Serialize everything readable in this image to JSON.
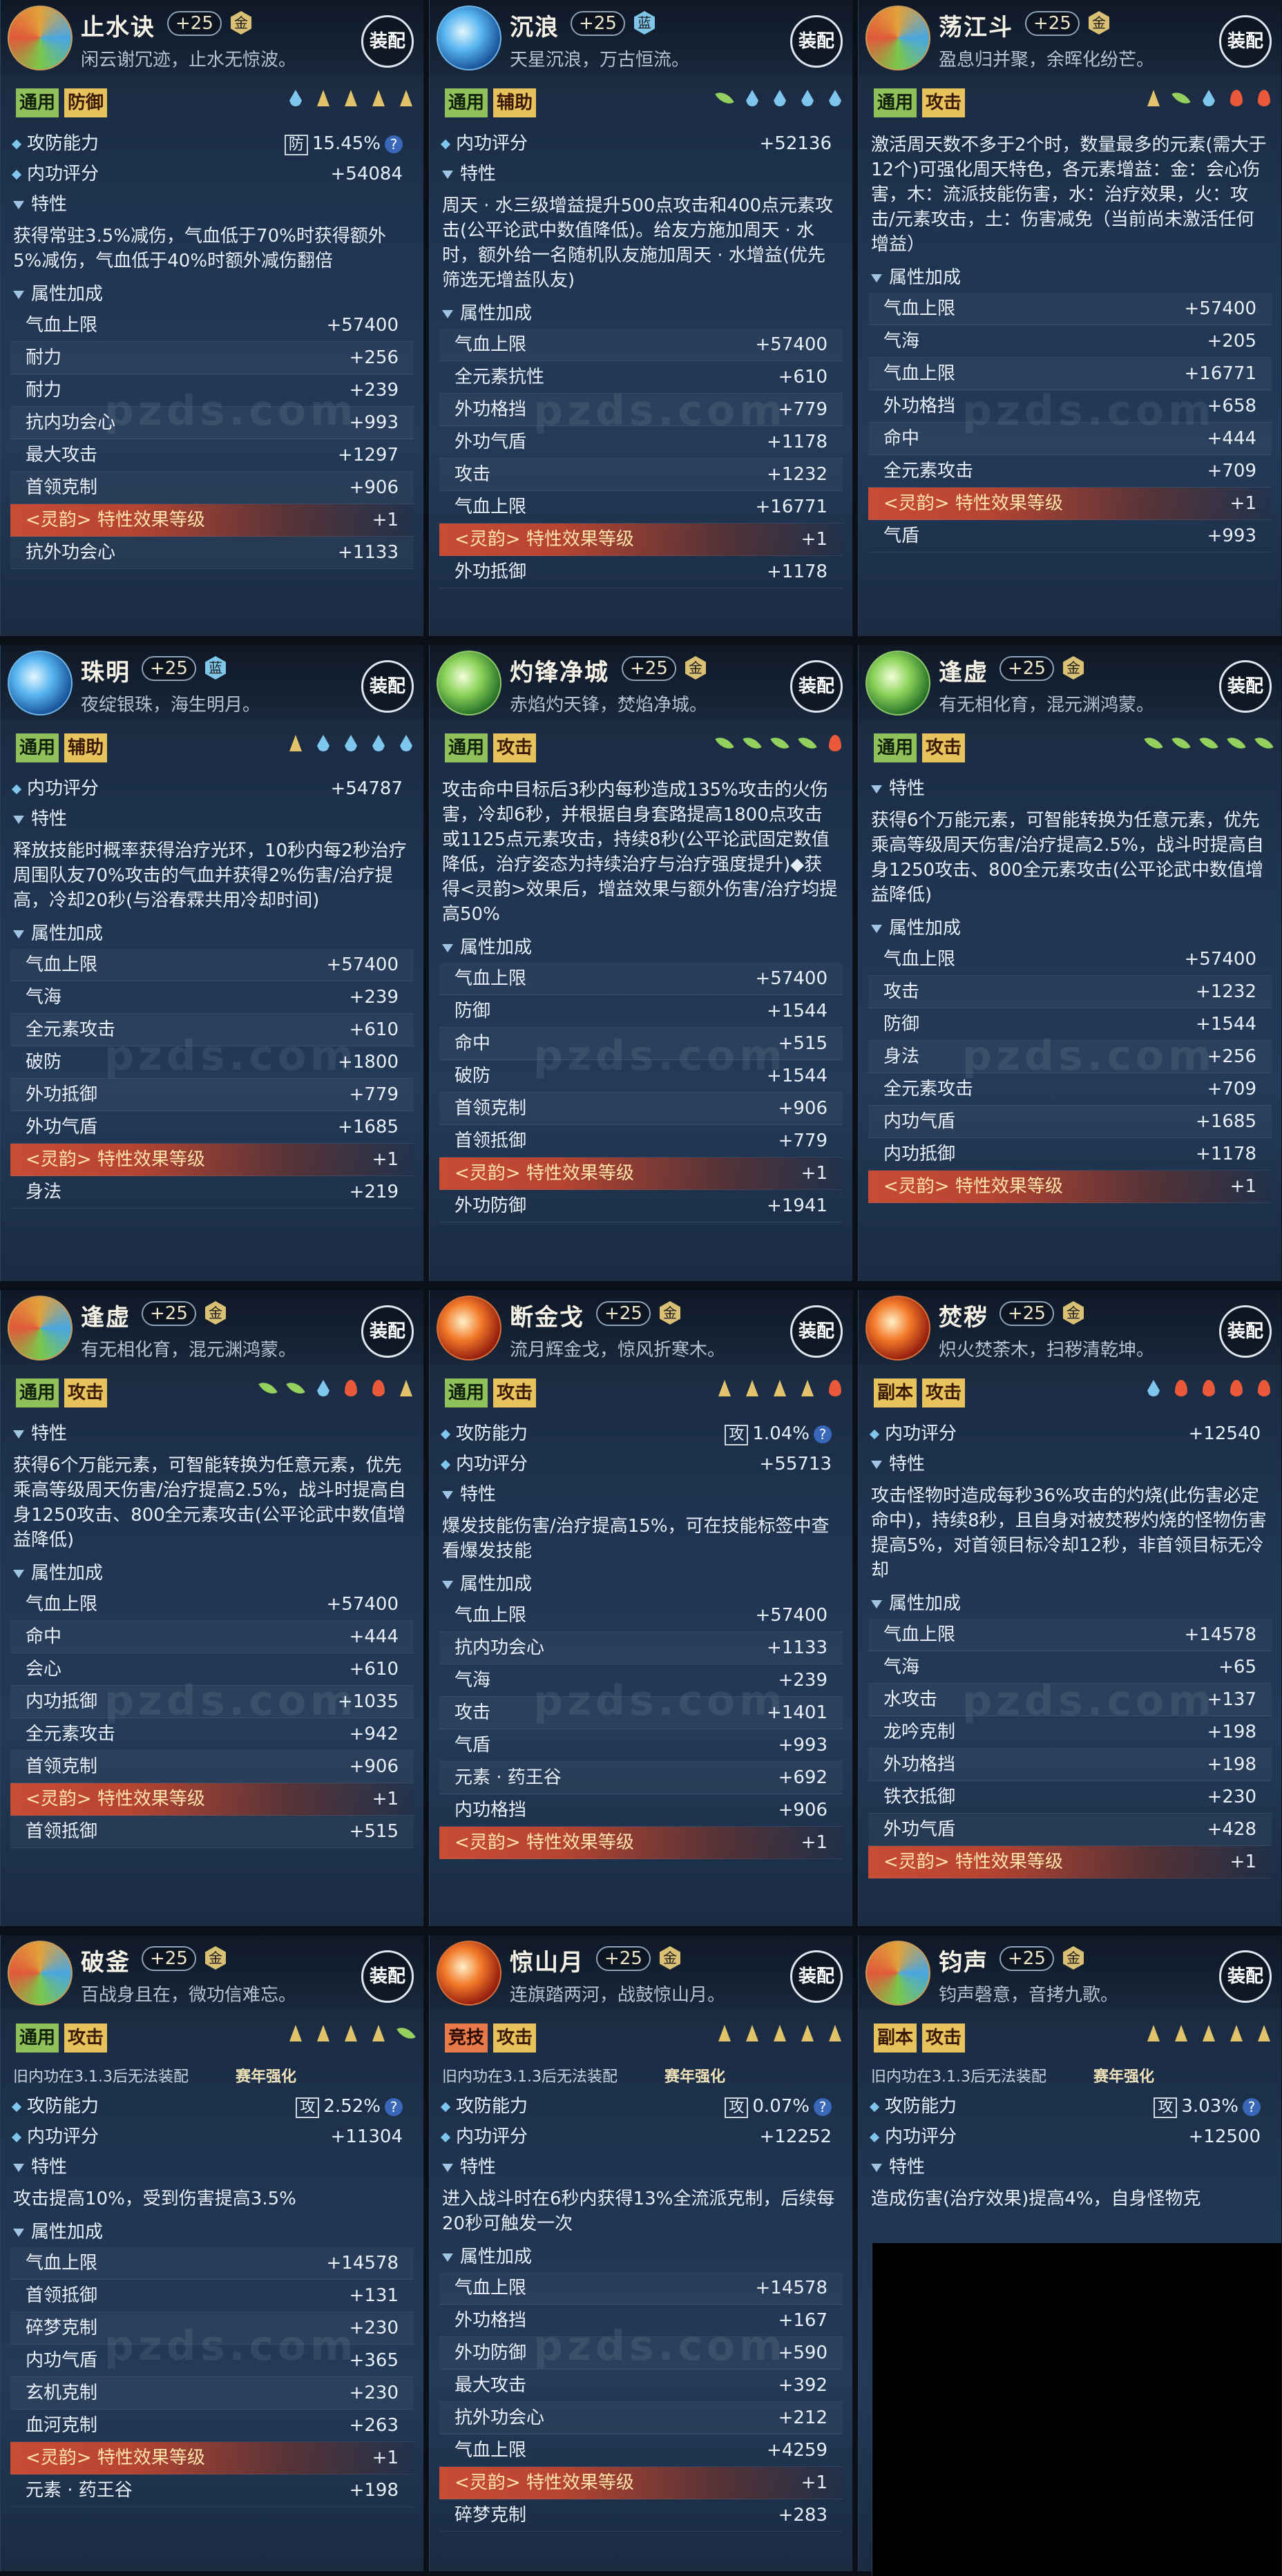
{
  "buttons": {
    "equip": "装配"
  },
  "watermark": "pzds.com",
  "sections": {
    "rating": "内功评分",
    "atk_def": "攻防能力",
    "trait": "特性",
    "attrs": "属性加成"
  },
  "cards": [
    {
      "title": "止水诀",
      "level": "+25",
      "badge": "金",
      "subtitle": "闲云谢冗迹，止水无惊波。",
      "tags": [
        {
          "text": "通用",
          "c": "g"
        },
        {
          "text": "防御",
          "c": "y"
        }
      ],
      "elements": [
        "water",
        "earth",
        "earth",
        "earth",
        "earth"
      ],
      "rows": [
        {
          "t": "sec",
          "icon": "dot",
          "label": "攻防能力",
          "box": "防",
          "value": "15.45%",
          "q": "?"
        },
        {
          "t": "sec",
          "icon": "dot",
          "label": "内功评分",
          "value": "+54084"
        },
        {
          "t": "sec",
          "icon": "tri",
          "label": "特性"
        },
        {
          "t": "desc",
          "text": "获得常驻3.5%减伤，气血低于70%时获得额外5%减伤，气血低于40%时额外减伤翻倍"
        },
        {
          "t": "sec",
          "icon": "tri",
          "label": "属性加成"
        },
        {
          "t": "stat",
          "name": "气血上限",
          "value": "+57400"
        },
        {
          "t": "stat",
          "name": "耐力",
          "value": "+256"
        },
        {
          "t": "stat",
          "name": "耐力",
          "value": "+239"
        },
        {
          "t": "stat",
          "name": "抗内功会心",
          "value": "+993"
        },
        {
          "t": "stat",
          "name": "最大攻击",
          "value": "+1297"
        },
        {
          "t": "stat",
          "name": "首领克制",
          "value": "+906"
        },
        {
          "t": "res",
          "name": "<灵韵> 特性效果等级",
          "value": "+1"
        },
        {
          "t": "stat",
          "name": "抗外功会心",
          "value": "+1133"
        }
      ]
    },
    {
      "title": "沉浪",
      "level": "+25",
      "badge": "蓝",
      "subtitle": "天星沉浪，万古恒流。",
      "tags": [
        {
          "text": "通用",
          "c": "g"
        },
        {
          "text": "辅助",
          "c": "y"
        }
      ],
      "elements": [
        "wood",
        "water",
        "water",
        "water",
        "water"
      ],
      "rows": [
        {
          "t": "sec",
          "icon": "dot",
          "label": "内功评分",
          "value": "+52136"
        },
        {
          "t": "sec",
          "icon": "tri",
          "label": "特性"
        },
        {
          "t": "desc",
          "text": "周天 · 水三级增益提升500点攻击和400点元素攻击(公平论武中数值降低)。给友方施加周天 · 水时，额外给一名随机队友施加周天 · 水增益(优先筛选无增益队友)"
        },
        {
          "t": "sec",
          "icon": "tri",
          "label": "属性加成"
        },
        {
          "t": "stat",
          "name": "气血上限",
          "value": "+57400"
        },
        {
          "t": "stat",
          "name": "全元素抗性",
          "value": "+610"
        },
        {
          "t": "stat",
          "name": "外功格挡",
          "value": "+779"
        },
        {
          "t": "stat",
          "name": "外功气盾",
          "value": "+1178"
        },
        {
          "t": "stat",
          "name": "攻击",
          "value": "+1232"
        },
        {
          "t": "stat",
          "name": "气血上限",
          "value": "+16771"
        },
        {
          "t": "res",
          "name": "<灵韵> 特性效果等级",
          "value": "+1"
        },
        {
          "t": "stat",
          "name": "外功抵御",
          "value": "+1178"
        }
      ]
    },
    {
      "title": "荡江斗",
      "level": "+25",
      "badge": "金",
      "subtitle": "盈息归并聚，余晖化纷芒。",
      "tags": [
        {
          "text": "通用",
          "c": "g"
        },
        {
          "text": "攻击",
          "c": "y"
        }
      ],
      "elements": [
        "earth",
        "wood",
        "water",
        "fire",
        "fire"
      ],
      "rows": [
        {
          "t": "desc",
          "text": "激活周天数不多于2个时，数量最多的元素(需大于12个)可强化周天特色，各元素增益：金：会心伤害，木：流派技能伤害，水：治疗效果，火：攻击/元素攻击，土：伤害减免（当前尚未激活任何增益）"
        },
        {
          "t": "sec",
          "icon": "tri",
          "label": "属性加成"
        },
        {
          "t": "stat",
          "name": "气血上限",
          "value": "+57400"
        },
        {
          "t": "stat",
          "name": "气海",
          "value": "+205"
        },
        {
          "t": "stat",
          "name": "气血上限",
          "value": "+16771"
        },
        {
          "t": "stat",
          "name": "外功格挡",
          "value": "+658"
        },
        {
          "t": "stat",
          "name": "命中",
          "value": "+444"
        },
        {
          "t": "stat",
          "name": "全元素攻击",
          "value": "+709"
        },
        {
          "t": "res",
          "name": "<灵韵> 特性效果等级",
          "value": "+1"
        },
        {
          "t": "stat",
          "name": "气盾",
          "value": "+993"
        }
      ]
    },
    {
      "title": "珠明",
      "level": "+25",
      "badge": "蓝",
      "subtitle": "夜绽银珠，海生明月。",
      "tags": [
        {
          "text": "通用",
          "c": "g"
        },
        {
          "text": "辅助",
          "c": "y"
        }
      ],
      "elements": [
        "earth",
        "water",
        "water",
        "water",
        "water"
      ],
      "rows": [
        {
          "t": "sec",
          "icon": "dot",
          "label": "内功评分",
          "value": "+54787"
        },
        {
          "t": "sec",
          "icon": "tri",
          "label": "特性"
        },
        {
          "t": "desc",
          "text": "释放技能时概率获得治疗光环，10秒内每2秒治疗周围队友70%攻击的气血并获得2%伤害/治疗提高，冷却20秒(与浴春霖共用冷却时间)"
        },
        {
          "t": "sec",
          "icon": "tri",
          "label": "属性加成"
        },
        {
          "t": "stat",
          "name": "气血上限",
          "value": "+57400"
        },
        {
          "t": "stat",
          "name": "气海",
          "value": "+239"
        },
        {
          "t": "stat",
          "name": "全元素攻击",
          "value": "+610"
        },
        {
          "t": "stat",
          "name": "破防",
          "value": "+1800"
        },
        {
          "t": "stat",
          "name": "外功抵御",
          "value": "+779"
        },
        {
          "t": "stat",
          "name": "外功气盾",
          "value": "+1685"
        },
        {
          "t": "res",
          "name": "<灵韵> 特性效果等级",
          "value": "+1"
        },
        {
          "t": "stat",
          "name": "身法",
          "value": "+219"
        }
      ]
    },
    {
      "title": "灼锋净城",
      "level": "+25",
      "badge": "金",
      "subtitle": "赤焰灼天锋，焚焰净城。",
      "tags": [
        {
          "text": "通用",
          "c": "g"
        },
        {
          "text": "攻击",
          "c": "y"
        }
      ],
      "elements": [
        "wood",
        "wood",
        "wood",
        "wood",
        "fire"
      ],
      "rows": [
        {
          "t": "desc",
          "text": "攻击命中目标后3秒内每秒造成135%攻击的火伤害，冷却6秒，并根据自身套路提高1800点攻击或1125点元素攻击，持续8秒(公平论武固定数值降低，治疗姿态为持续治疗与治疗强度提升)◆获得<灵韵>效果后，增益效果与额外伤害/治疗均提高50%"
        },
        {
          "t": "sec",
          "icon": "tri",
          "label": "属性加成"
        },
        {
          "t": "stat",
          "name": "气血上限",
          "value": "+57400"
        },
        {
          "t": "stat",
          "name": "防御",
          "value": "+1544"
        },
        {
          "t": "stat",
          "name": "命中",
          "value": "+515"
        },
        {
          "t": "stat",
          "name": "破防",
          "value": "+1544"
        },
        {
          "t": "stat",
          "name": "首领克制",
          "value": "+906"
        },
        {
          "t": "stat",
          "name": "首领抵御",
          "value": "+779"
        },
        {
          "t": "res",
          "name": "<灵韵> 特性效果等级",
          "value": "+1"
        },
        {
          "t": "stat",
          "name": "外功防御",
          "value": "+1941"
        }
      ]
    },
    {
      "title": "逢虚",
      "level": "+25",
      "badge": "金",
      "subtitle": "有无相化育，混元渊鸿蒙。",
      "tags": [
        {
          "text": "通用",
          "c": "g"
        },
        {
          "text": "攻击",
          "c": "y"
        }
      ],
      "elements": [
        "wood",
        "wood",
        "wood",
        "wood",
        "wood"
      ],
      "rows": [
        {
          "t": "sec",
          "icon": "tri",
          "label": "特性"
        },
        {
          "t": "desc",
          "text": "获得6个万能元素，可智能转换为任意元素，优先乘高等级周天伤害/治疗提高2.5%，战斗时提高自身1250攻击、800全元素攻击(公平论武中数值增益降低)"
        },
        {
          "t": "sec",
          "icon": "tri",
          "label": "属性加成"
        },
        {
          "t": "stat",
          "name": "气血上限",
          "value": "+57400"
        },
        {
          "t": "stat",
          "name": "攻击",
          "value": "+1232"
        },
        {
          "t": "stat",
          "name": "防御",
          "value": "+1544"
        },
        {
          "t": "stat",
          "name": "身法",
          "value": "+256"
        },
        {
          "t": "stat",
          "name": "全元素攻击",
          "value": "+709"
        },
        {
          "t": "stat",
          "name": "内功气盾",
          "value": "+1685"
        },
        {
          "t": "stat",
          "name": "内功抵御",
          "value": "+1178"
        },
        {
          "t": "res",
          "name": "<灵韵> 特性效果等级",
          "value": "+1"
        }
      ]
    },
    {
      "title": "逢虚",
      "level": "+25",
      "badge": "金",
      "subtitle": "有无相化育，混元渊鸿蒙。",
      "tags": [
        {
          "text": "通用",
          "c": "g"
        },
        {
          "text": "攻击",
          "c": "y"
        }
      ],
      "elements": [
        "wood",
        "wood",
        "water",
        "fire",
        "fire",
        "earth"
      ],
      "rows": [
        {
          "t": "sec",
          "icon": "tri",
          "label": "特性"
        },
        {
          "t": "desc",
          "text": "获得6个万能元素，可智能转换为任意元素，优先乘高等级周天伤害/治疗提高2.5%，战斗时提高自身1250攻击、800全元素攻击(公平论武中数值增益降低)"
        },
        {
          "t": "sec",
          "icon": "tri",
          "label": "属性加成"
        },
        {
          "t": "stat",
          "name": "气血上限",
          "value": "+57400"
        },
        {
          "t": "stat",
          "name": "命中",
          "value": "+444"
        },
        {
          "t": "stat",
          "name": "会心",
          "value": "+610"
        },
        {
          "t": "stat",
          "name": "内功抵御",
          "value": "+1035"
        },
        {
          "t": "stat",
          "name": "全元素攻击",
          "value": "+942"
        },
        {
          "t": "stat",
          "name": "首领克制",
          "value": "+906"
        },
        {
          "t": "res",
          "name": "<灵韵> 特性效果等级",
          "value": "+1"
        },
        {
          "t": "stat",
          "name": "首领抵御",
          "value": "+515"
        }
      ]
    },
    {
      "title": "断金戈",
      "level": "+25",
      "badge": "金",
      "subtitle": "流月辉金戈，惊风折寒木。",
      "tags": [
        {
          "text": "通用",
          "c": "g"
        },
        {
          "text": "攻击",
          "c": "y"
        }
      ],
      "elements": [
        "earth",
        "earth",
        "earth",
        "earth",
        "fire"
      ],
      "rows": [
        {
          "t": "sec",
          "icon": "dot",
          "label": "攻防能力",
          "box": "攻",
          "value": "1.04%",
          "q": "?"
        },
        {
          "t": "sec",
          "icon": "dot",
          "label": "内功评分",
          "value": "+55713"
        },
        {
          "t": "sec",
          "icon": "tri",
          "label": "特性"
        },
        {
          "t": "desc",
          "text": "爆发技能伤害/治疗提高15%，可在技能标签中查看爆发技能"
        },
        {
          "t": "sec",
          "icon": "tri",
          "label": "属性加成"
        },
        {
          "t": "stat",
          "name": "气血上限",
          "value": "+57400"
        },
        {
          "t": "stat",
          "name": "抗内功会心",
          "value": "+1133"
        },
        {
          "t": "stat",
          "name": "气海",
          "value": "+239"
        },
        {
          "t": "stat",
          "name": "攻击",
          "value": "+1401"
        },
        {
          "t": "stat",
          "name": "气盾",
          "value": "+993"
        },
        {
          "t": "stat",
          "name": "元素 · 药王谷",
          "value": "+692"
        },
        {
          "t": "stat",
          "name": "内功格挡",
          "value": "+906"
        },
        {
          "t": "res",
          "name": "<灵韵> 特性效果等级",
          "value": "+1"
        }
      ]
    },
    {
      "title": "焚秽",
      "level": "+25",
      "badge": "金",
      "subtitle": "炽火焚荼木，扫秽清乾坤。",
      "tags": [
        {
          "text": "副本",
          "c": "y"
        },
        {
          "text": "攻击",
          "c": "y"
        }
      ],
      "elements": [
        "water",
        "fire",
        "fire",
        "fire",
        "fire"
      ],
      "rows": [
        {
          "t": "sec",
          "icon": "dot",
          "label": "内功评分",
          "value": "+12540"
        },
        {
          "t": "sec",
          "icon": "tri",
          "label": "特性"
        },
        {
          "t": "desc",
          "text": "攻击怪物时造成每秒36%攻击的灼烧(此伤害必定命中)，持续8秒，且自身对被焚秽灼烧的怪物伤害提高5%，对首领目标冷却12秒，非首领目标无冷却"
        },
        {
          "t": "sec",
          "icon": "tri",
          "label": "属性加成"
        },
        {
          "t": "stat",
          "name": "气血上限",
          "value": "+14578"
        },
        {
          "t": "stat",
          "name": "气海",
          "value": "+65"
        },
        {
          "t": "stat",
          "name": "水攻击",
          "value": "+137"
        },
        {
          "t": "stat",
          "name": "龙吟克制",
          "value": "+198"
        },
        {
          "t": "stat",
          "name": "外功格挡",
          "value": "+198"
        },
        {
          "t": "stat",
          "name": "铁衣抵御",
          "value": "+230"
        },
        {
          "t": "stat",
          "name": "外功气盾",
          "value": "+428"
        },
        {
          "t": "res",
          "name": "<灵韵> 特性效果等级",
          "value": "+1"
        }
      ]
    },
    {
      "title": "破釜",
      "level": "+25",
      "badge": "金",
      "subtitle": "百战身且在，微功信难忘。",
      "tags": [
        {
          "text": "通用",
          "c": "g"
        },
        {
          "text": "攻击",
          "c": "y"
        }
      ],
      "elements": [
        "earth",
        "earth",
        "earth",
        "earth",
        "wood"
      ],
      "rows": [
        {
          "t": "notice",
          "text": "旧内功在3.1.3后无法装配",
          "badge": "赛年强化"
        },
        {
          "t": "sec",
          "icon": "dot",
          "label": "攻防能力",
          "box": "攻",
          "value": "2.52%",
          "q": "?"
        },
        {
          "t": "sec",
          "icon": "dot",
          "label": "内功评分",
          "value": "+11304"
        },
        {
          "t": "sec",
          "icon": "tri",
          "label": "特性"
        },
        {
          "t": "desc",
          "text": "攻击提高10%，受到伤害提高3.5%"
        },
        {
          "t": "sec",
          "icon": "tri",
          "label": "属性加成"
        },
        {
          "t": "stat",
          "name": "气血上限",
          "value": "+14578"
        },
        {
          "t": "stat",
          "name": "首领抵御",
          "value": "+131"
        },
        {
          "t": "stat",
          "name": "碎梦克制",
          "value": "+230"
        },
        {
          "t": "stat",
          "name": "内功气盾",
          "value": "+365"
        },
        {
          "t": "stat",
          "name": "玄机克制",
          "value": "+230"
        },
        {
          "t": "stat",
          "name": "血河克制",
          "value": "+263"
        },
        {
          "t": "res",
          "name": "<灵韵> 特性效果等级",
          "value": "+1"
        },
        {
          "t": "stat",
          "name": "元素 · 药王谷",
          "value": "+198"
        }
      ]
    },
    {
      "title": "惊山月",
      "level": "+25",
      "badge": "金",
      "subtitle": "连旗踏两河，战鼓惊山月。",
      "tags": [
        {
          "text": "竞技",
          "c": "r"
        },
        {
          "text": "攻击",
          "c": "y"
        }
      ],
      "elements": [
        "earth",
        "earth",
        "earth",
        "earth",
        "earth"
      ],
      "rows": [
        {
          "t": "notice",
          "text": "旧内功在3.1.3后无法装配",
          "badge": "赛年强化"
        },
        {
          "t": "sec",
          "icon": "dot",
          "label": "攻防能力",
          "box": "攻",
          "value": "0.07%",
          "q": "?"
        },
        {
          "t": "sec",
          "icon": "dot",
          "label": "内功评分",
          "value": "+12252"
        },
        {
          "t": "sec",
          "icon": "tri",
          "label": "特性"
        },
        {
          "t": "desc",
          "text": "进入战斗时在6秒内获得13%全流派克制，后续每20秒可触发一次"
        },
        {
          "t": "sec",
          "icon": "tri",
          "label": "属性加成"
        },
        {
          "t": "stat",
          "name": "气血上限",
          "value": "+14578"
        },
        {
          "t": "stat",
          "name": "外功格挡",
          "value": "+167"
        },
        {
          "t": "stat",
          "name": "外功防御",
          "value": "+590"
        },
        {
          "t": "stat",
          "name": "最大攻击",
          "value": "+392"
        },
        {
          "t": "stat",
          "name": "抗外功会心",
          "value": "+212"
        },
        {
          "t": "stat",
          "name": "气血上限",
          "value": "+4259"
        },
        {
          "t": "res",
          "name": "<灵韵> 特性效果等级",
          "value": "+1"
        },
        {
          "t": "stat",
          "name": "碎梦克制",
          "value": "+283"
        }
      ]
    },
    {
      "title": "钧声",
      "level": "+25",
      "badge": "金",
      "subtitle": "钧声磬意，音拷九歌。",
      "tags": [
        {
          "text": "副本",
          "c": "y"
        },
        {
          "text": "攻击",
          "c": "y"
        }
      ],
      "elements": [
        "earth",
        "earth",
        "earth",
        "earth",
        "earth"
      ],
      "rows": [
        {
          "t": "notice",
          "text": "旧内功在3.1.3后无法装配",
          "badge": "赛年强化"
        },
        {
          "t": "sec",
          "icon": "dot",
          "label": "攻防能力",
          "box": "攻",
          "value": "3.03%",
          "q": "?"
        },
        {
          "t": "sec",
          "icon": "dot",
          "label": "内功评分",
          "value": "+12500"
        },
        {
          "t": "sec",
          "icon": "tri",
          "label": "特性"
        },
        {
          "t": "desc",
          "text": "造成伤害(治疗效果)提高4%，自身怪物克"
        }
      ]
    }
  ]
}
